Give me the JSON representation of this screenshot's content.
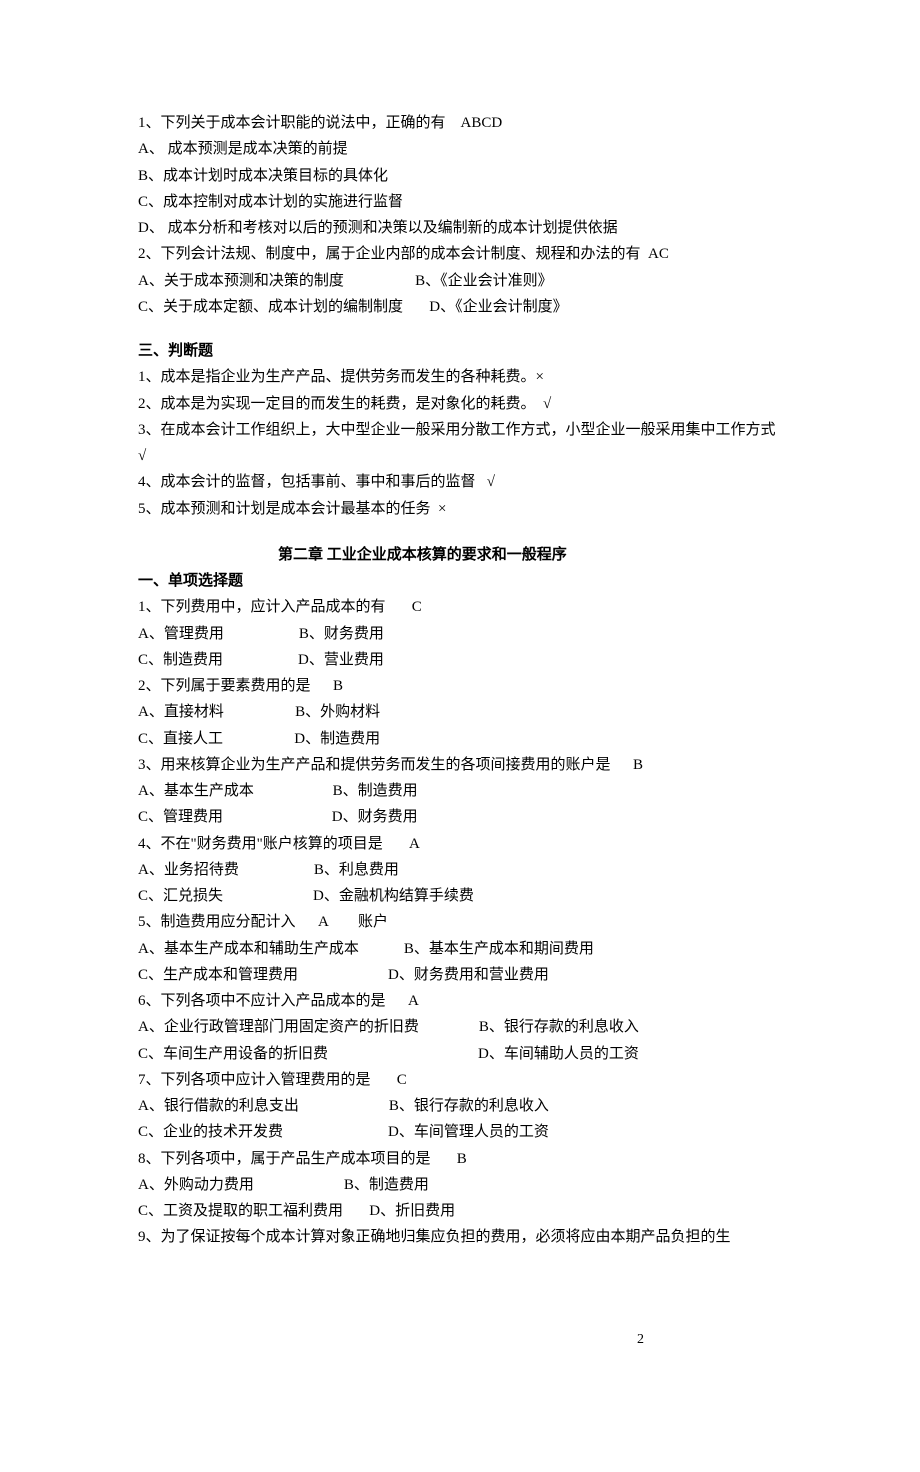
{
  "q1": {
    "stem": "1、下列关于成本会计职能的说法中，正确的有    ABCD            ",
    "a": "A、 成本预测是成本决策的前提",
    "b": "B、成本计划时成本决策目标的具体化",
    "c": "C、成本控制对成本计划的实施进行监督",
    "d": "D、 成本分析和考核对以后的预测和决策以及编制新的成本计划提供依据"
  },
  "q2": {
    "stem": "2、下列会计法规、制度中，属于企业内部的成本会计制度、规程和办法的有  AC",
    "row1": "A、关于成本预测和决策的制度                   B、《企业会计准则》",
    "row2": "C、关于成本定额、成本计划的编制制度       D、《企业会计制度》"
  },
  "sec3": {
    "title": "三、判断题",
    "i1": "1、成本是指企业为生产产品、提供劳务而发生的各种耗费。×",
    "i2": "2、成本是为实现一定目的而发生的耗费，是对象化的耗费。  √",
    "i3": "3、在成本会计工作组织上，大中型企业一般采用分散工作方式，小型企业一般采用集中工作方式   √",
    "i4": "4、成本会计的监督，包括事前、事中和事后的监督   √",
    "i5": "5、成本预测和计划是成本会计最基本的任务  ×"
  },
  "chapter2": {
    "title": "第二章         工业企业成本核算的要求和一般程序"
  },
  "sec1b": {
    "title": "一、单项选择题"
  },
  "c2q1": {
    "stem": "1、下列费用中，应计入产品成本的有       C         ",
    "row1": "A、管理费用                    B、财务费用",
    "row2": "C、制造费用                    D、营业费用"
  },
  "c2q2": {
    "stem": "2、下列属于要素费用的是      B       ",
    "row1": "A、直接材料                   B、外购材料",
    "row2": "C、直接人工                   D、制造费用"
  },
  "c2q3": {
    "stem": "3、用来核算企业为生产产品和提供劳务而发生的各项间接费用的账户是      B         ",
    "row1": "A、基本生产成本                     B、制造费用",
    "row2": "C、管理费用                             D、财务费用"
  },
  "c2q4": {
    "stem": "4、不在\"财务费用\"账户核算的项目是       A            ",
    "row1": "A、业务招待费                    B、利息费用",
    "row2": "C、汇兑损失                        D、金融机构结算手续费"
  },
  "c2q5": {
    "stem": "5、制造费用应分配计入      A        账户",
    "row1": "A、基本生产成本和辅助生产成本            B、基本生产成本和期间费用",
    "row2": "C、生产成本和管理费用                        D、财务费用和营业费用"
  },
  "c2q6": {
    "stem": "6、下列各项中不应计入产品成本的是      A          ",
    "row1": "A、企业行政管理部门用固定资产的折旧费                B、银行存款的利息收入",
    "row2": "C、车间生产用设备的折旧费                                        D、车间辅助人员的工资"
  },
  "c2q7": {
    "stem": "7、下列各项中应计入管理费用的是       C          ",
    "row1": "A、银行借款的利息支出                        B、银行存款的利息收入",
    "row2": "C、企业的技术开发费                            D、车间管理人员的工资"
  },
  "c2q8": {
    "stem": "8、下列各项中，属于产品生产成本项目的是       B            ",
    "row1": "A、外购动力费用                        B、制造费用",
    "row2": "C、工资及提取的职工福利费用       D、折旧费用"
  },
  "c2q9": {
    "stem": "9、为了保证按每个成本计算对象正确地归集应负担的费用，必须将应由本期产品负担的生"
  },
  "page": "2"
}
